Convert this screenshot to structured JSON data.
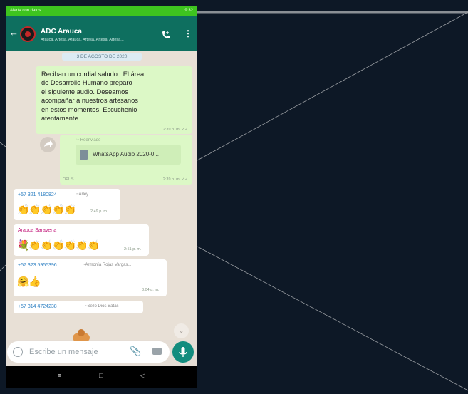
{
  "statusbar": {
    "left": "Alerta con datos",
    "right": "9:32"
  },
  "header": {
    "back_icon": "arrow-left-icon",
    "title": "ADC Arauca",
    "subtitle": "Arauca, Artesa, Arauca, Artesa, Artesa, Artesa...",
    "call_icon": "add-call-icon",
    "menu_icon": "more-vertical-icon"
  },
  "chat": {
    "date_chip": "3 DE AGOSTO DE 2020",
    "message1": {
      "text": "Reciban un cordial saludo . El área\nde Desarrollo Humano preparo\nel siguiente audio. Deseamos\nacompañar a nuestros artesanos\nen estos momentos. Escuchenlo\natentamente .",
      "time": "2:39 p. m. ✓✓"
    },
    "message2": {
      "forwarded": "↪ Reenviado",
      "file_name": "WhatsApp Audio 2020-0...",
      "file_type": "OPUS",
      "time": "2:39 p. m. ✓✓"
    },
    "message3": {
      "sender": "+57 321 4180824",
      "alias": "~Arley",
      "emojis": "👏👏👏👏👏",
      "time": "2:49 p. m."
    },
    "message4": {
      "sender": "Arauca Saravena",
      "emojis": "💐👏👏👏👏👏👏",
      "time": "2:51 p. m."
    },
    "message5": {
      "sender": "+57 323 5955396",
      "alias": "~Armonía Rojas Vargas...",
      "emojis": "🤗👍",
      "time": "3:04 p. m."
    },
    "message6": {
      "sender": "+57 314 4724238",
      "alias": "~Sello Dios Batas"
    }
  },
  "input": {
    "placeholder": "Escribe un mensaje",
    "emoji_icon": "smiley-icon",
    "attach_icon": "paperclip-icon",
    "camera_icon": "camera-icon",
    "mic_icon": "microphone-icon"
  },
  "navbar": {
    "menu": "≡",
    "home": "□",
    "back": "◁"
  },
  "colors": {
    "header": "#0e6f5f",
    "statusbar": "#3ec41f",
    "bubble_out": "#dcf8c6",
    "bubble_in": "#ffffff",
    "accent": "#128c7e",
    "sender_blue": "#2c7fc2",
    "sender_pink": "#c2187a"
  }
}
